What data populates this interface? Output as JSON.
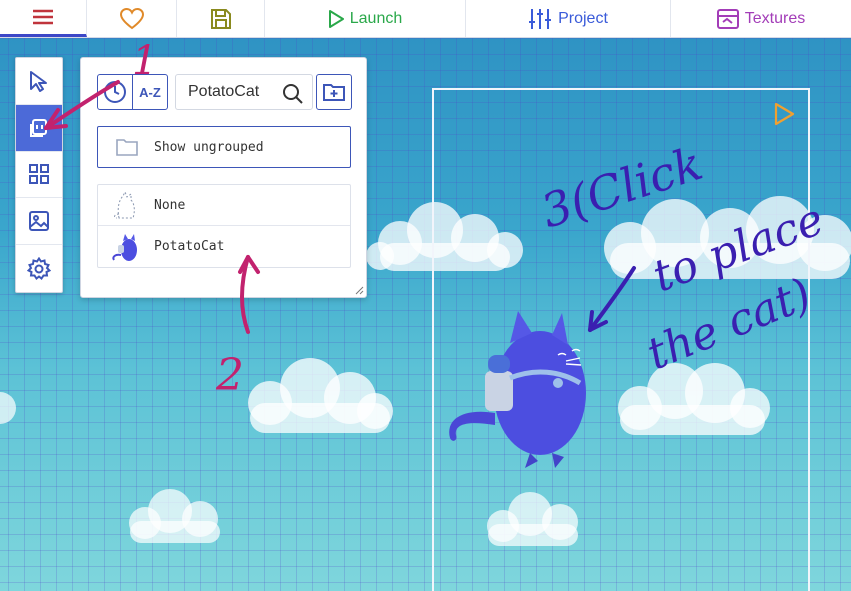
{
  "toolbar": {
    "menu_icon": "hamburger-icon",
    "favorite_icon": "heart-icon",
    "save_icon": "save-icon",
    "launch_label": "Launch",
    "project_label": "Project",
    "textures_label": "Textures",
    "colors": {
      "launch": "#2aa84a",
      "project": "#3a5bd9",
      "textures": "#a33db8",
      "menu": "#c0343c",
      "favorite": "#e08a2a",
      "save": "#8a8a1e"
    }
  },
  "sidebar": {
    "items": [
      {
        "name": "select",
        "icon": "cursor-icon"
      },
      {
        "name": "templates",
        "icon": "copy-template-icon",
        "active": true
      },
      {
        "name": "tiles",
        "icon": "grid-icon"
      },
      {
        "name": "backgrounds",
        "icon": "image-icon"
      },
      {
        "name": "settings",
        "icon": "gear-icon"
      }
    ]
  },
  "template_panel": {
    "sort_time_icon": "clock-icon",
    "sort_az_label": "A-Z",
    "search": {
      "value": "PotatoCat",
      "placeholder": "",
      "icon": "search-icon"
    },
    "add_folder_icon": "folder-plus-icon",
    "show_ungrouped_label": "Show ungrouped",
    "templates": [
      {
        "label": "None",
        "thumb": "ghost-cat-outline"
      },
      {
        "label": "PotatoCat",
        "thumb": "potato-cat"
      }
    ]
  },
  "annotations": {
    "step1": "1",
    "step2": "2",
    "step3_lines": [
      "3(Click",
      "to place",
      "the cat)"
    ],
    "color_steps": "#c2226e",
    "color_step3": "#3a1fb0"
  },
  "viewport": {
    "play_icon": "play-outline-icon"
  }
}
